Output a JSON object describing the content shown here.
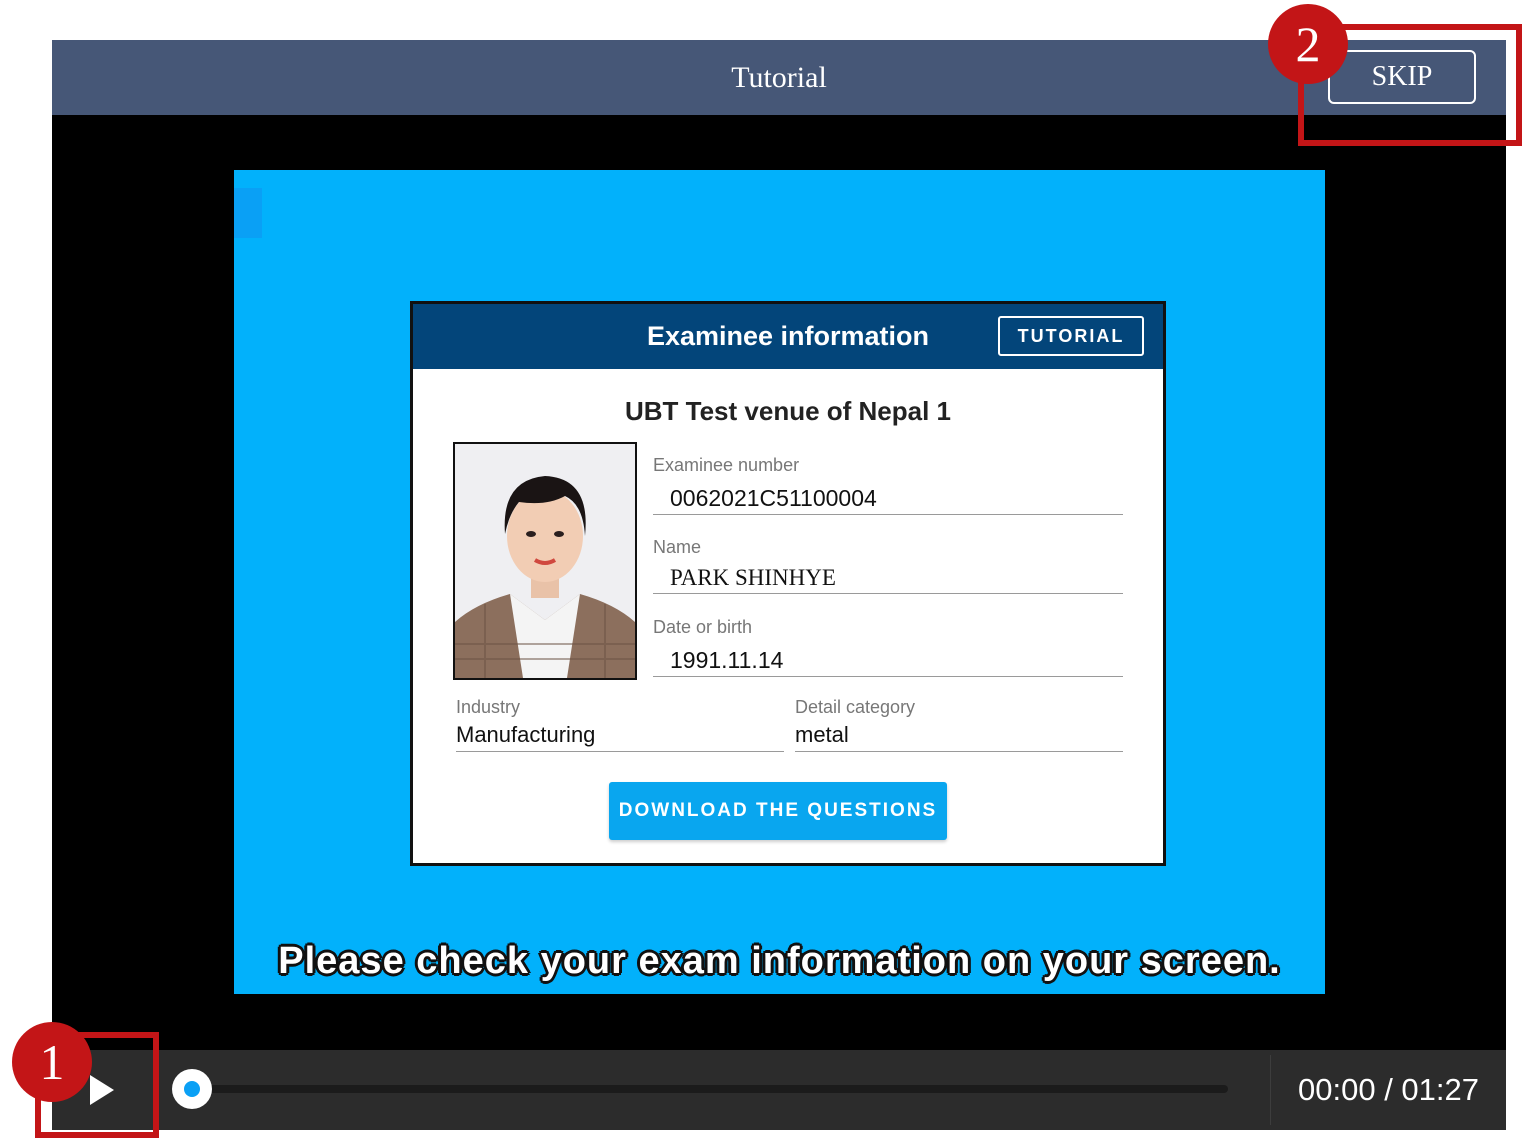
{
  "window": {
    "title": "Tutorial",
    "skip_label": "SKIP"
  },
  "card": {
    "header": "Examinee information",
    "tutorial_button": "TUTORIAL",
    "venue": "UBT Test venue of Nepal 1",
    "fields": {
      "examinee_number": {
        "label": "Examinee number",
        "value": "0062021C51100004"
      },
      "name": {
        "label": "Name",
        "value": "PARK SHINHYE"
      },
      "dob": {
        "label": "Date or birth",
        "value": "1991.11.14"
      },
      "industry": {
        "label": "Industry",
        "value": "Manufacturing"
      },
      "detail_category": {
        "label": "Detail category",
        "value": "metal"
      }
    },
    "download_button": "DOWNLOAD THE QUESTIONS"
  },
  "subtitle": "Please check your exam information on your screen.",
  "player": {
    "time": "00:00 / 01:27",
    "progress": 0
  },
  "annotations": {
    "badge_1": "1",
    "badge_2": "2"
  },
  "colors": {
    "titlebar": "#465777",
    "video_bg": "#02b1fb",
    "card_header": "#03457a",
    "accent": "#09a6ef",
    "highlight": "#c31517"
  },
  "icons": {
    "play": "play-icon"
  }
}
